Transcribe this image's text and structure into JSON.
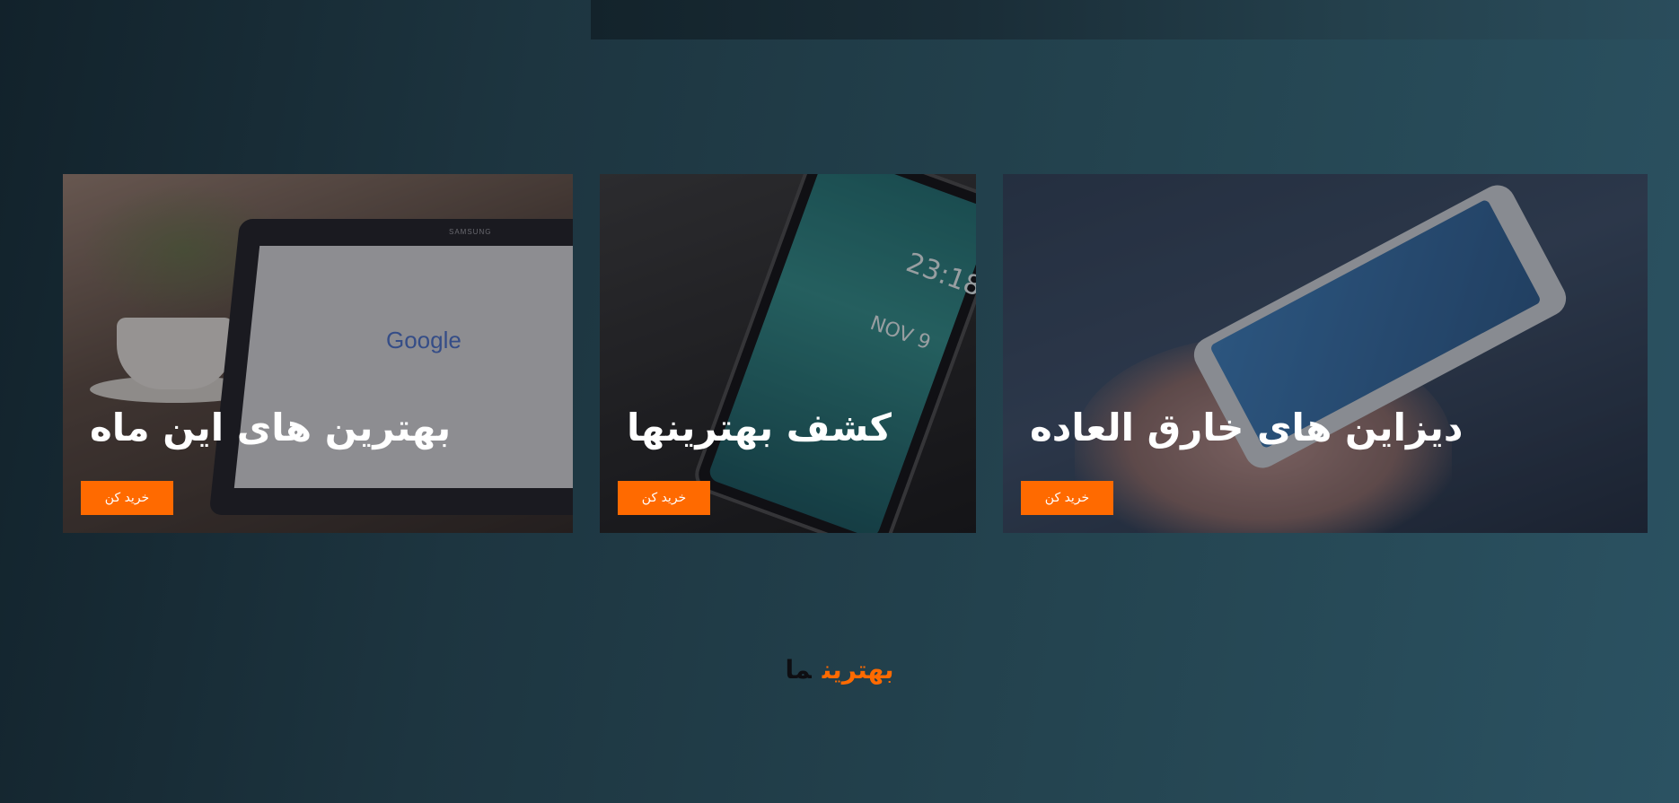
{
  "cards": [
    {
      "title": "بهترین های این ماه",
      "button_label": "خرید کن",
      "image_label": "tablet with Google search on screen",
      "image_text": [
        "SAMSUNG",
        "Google"
      ]
    },
    {
      "title": "کشف بهترینها",
      "button_label": "خرید کن",
      "image_label": "smartphone lying on a world map",
      "image_text": [
        "23:18",
        "NOV 9"
      ]
    },
    {
      "title": "دیزاین های خارق العاده",
      "button_label": "خرید کن",
      "image_label": "hands holding a smartphone"
    }
  ],
  "section_heading": {
    "accent": "بهترین",
    "rest": "ما"
  },
  "colors": {
    "accent": "#ff6a00",
    "background_start": "#12222b",
    "background_end": "#2b5262",
    "heading_dark": "#0e0e12"
  }
}
